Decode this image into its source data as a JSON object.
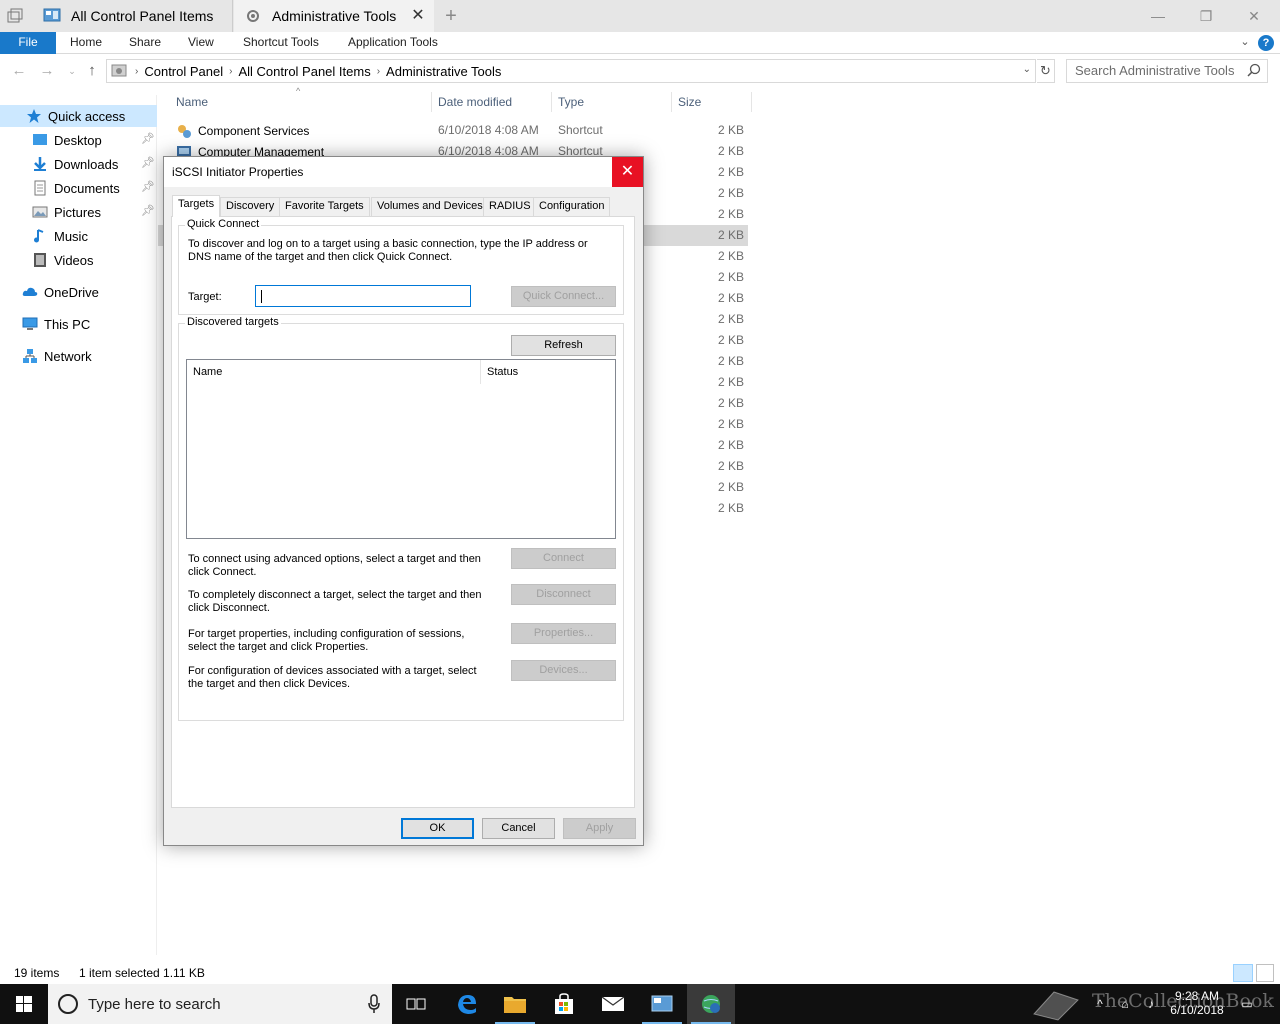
{
  "window": {
    "tabs": [
      {
        "label": "All Control Panel Items"
      },
      {
        "label": "Administrative Tools"
      }
    ]
  },
  "ribbon": {
    "file": "File",
    "home": "Home",
    "share": "Share",
    "view": "View",
    "shortcut_tools": "Shortcut Tools",
    "application_tools": "Application Tools",
    "help": "?"
  },
  "address": {
    "crumbs": [
      "Control Panel",
      "All Control Panel Items",
      "Administrative Tools"
    ],
    "search_placeholder": "Search Administrative Tools"
  },
  "navpane": {
    "items": [
      {
        "label": "Quick access",
        "icon": "star-icon"
      },
      {
        "label": "Desktop",
        "icon": "desktop-icon"
      },
      {
        "label": "Downloads",
        "icon": "download-icon"
      },
      {
        "label": "Documents",
        "icon": "documents-icon"
      },
      {
        "label": "Pictures",
        "icon": "pictures-icon"
      },
      {
        "label": "Music",
        "icon": "music-icon"
      },
      {
        "label": "Videos",
        "icon": "videos-icon"
      },
      {
        "label": "OneDrive",
        "icon": "cloud-icon"
      },
      {
        "label": "This PC",
        "icon": "computer-icon"
      },
      {
        "label": "Network",
        "icon": "network-icon"
      }
    ]
  },
  "filelist": {
    "columns": {
      "name": "Name",
      "date": "Date modified",
      "type": "Type",
      "size": "Size"
    },
    "rows": [
      {
        "name": "Component Services",
        "date": "6/10/2018 4:08 AM",
        "type": "Shortcut",
        "size": "2 KB"
      },
      {
        "name": "Computer Management",
        "date": "6/10/2018 4:08 AM",
        "type": "Shortcut",
        "size": "2 KB"
      }
    ],
    "size_col": [
      "2 KB",
      "2 KB",
      "2 KB",
      "2 KB",
      "2 KB",
      "2 KB",
      "2 KB",
      "2 KB",
      "2 KB",
      "2 KB",
      "2 KB",
      "2 KB",
      "2 KB",
      "2 KB",
      "2 KB",
      "2 KB",
      "2 KB",
      "2 KB",
      "2 KB"
    ]
  },
  "status": {
    "count": "19 items",
    "selected": "1 item selected  1.11 KB"
  },
  "dialog": {
    "title": "iSCSI Initiator Properties",
    "tabs": [
      "Targets",
      "Discovery",
      "Favorite Targets",
      "Volumes and Devices",
      "RADIUS",
      "Configuration"
    ],
    "quick_connect": {
      "label": "Quick Connect",
      "desc": "To discover and log on to a target using a basic connection, type the IP address or DNS name of the target and then click Quick Connect.",
      "target_label": "Target:",
      "target_value": "",
      "button": "Quick Connect..."
    },
    "discovered": {
      "label": "Discovered targets",
      "refresh": "Refresh",
      "col_name": "Name",
      "col_status": "Status"
    },
    "actions": [
      {
        "desc": "To connect using advanced options, select a target and then click Connect.",
        "button": "Connect"
      },
      {
        "desc": "To completely disconnect a target, select the target and then click Disconnect.",
        "button": "Disconnect"
      },
      {
        "desc": "For target properties, including configuration of sessions, select the target and click Properties.",
        "button": "Properties..."
      },
      {
        "desc": "For configuration of devices associated with a target, select the target and then click Devices.",
        "button": "Devices..."
      }
    ],
    "ok": "OK",
    "cancel": "Cancel",
    "apply": "Apply"
  },
  "taskbar": {
    "search_placeholder": "Type here to search",
    "time": "9:28 AM",
    "date": "6/10/2018"
  },
  "watermark": "TheCollectionBook",
  "colors": {
    "accent": "#0078d7",
    "file_tab": "#1979ca",
    "close_red": "#e81123",
    "selection": "#cce8ff"
  }
}
